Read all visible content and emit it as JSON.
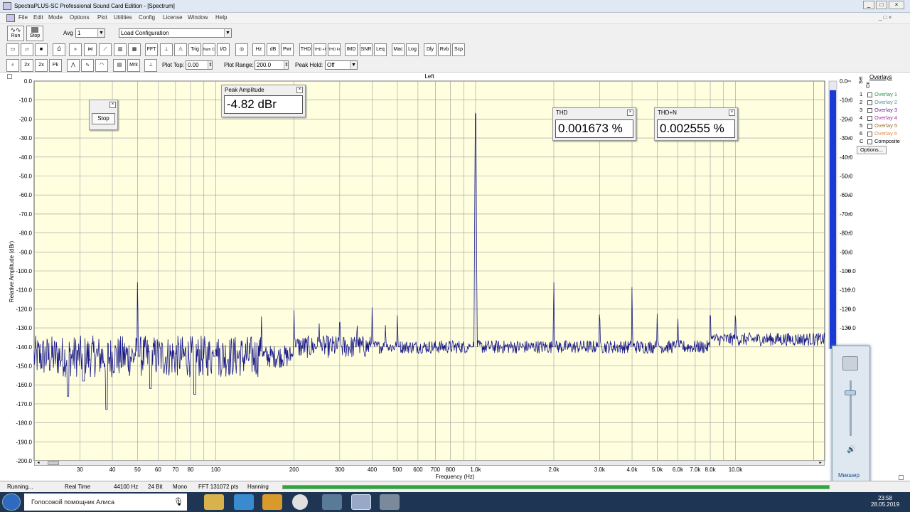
{
  "window": {
    "title": "SpectraPLUS-SC Professional Sound Card Edition - [Spectrum]"
  },
  "menu": [
    "File",
    "Edit",
    "Mode",
    "Options",
    "Plot",
    "Utilities",
    "Config",
    "License",
    "Window",
    "Help"
  ],
  "toolbar": {
    "run_label": "Run",
    "stop_label": "Stop",
    "avg_label": "Avg",
    "avg_value": "1",
    "config_value": "Load Configuration",
    "buttons": [
      "FFT",
      "Trig",
      "Num Ctrl",
      "I/O",
      "Hz",
      "dB",
      "Pwr",
      "THD",
      "THD +N",
      "THD Freq",
      "IMD",
      "SNR",
      "Leq",
      "Mac",
      "Log",
      "Dly",
      "Rvb",
      "Scp"
    ],
    "mrk_label": "Mrk",
    "plot_top_label": "Plot Top:",
    "plot_top_value": "0.00",
    "plot_range_label": "Plot Range:",
    "plot_range_value": "200.0",
    "peak_hold_label": "Peak Hold:",
    "peak_hold_value": "Off"
  },
  "stop_panel": {
    "button": "Stop"
  },
  "peak_panel": {
    "title": "Peak Amplitude",
    "value": "-4.82 dBr"
  },
  "thd_panel": {
    "title": "THD",
    "value": "0.001673 %"
  },
  "thdn_panel": {
    "title": "THD+N",
    "value": "0.002555 %"
  },
  "overlays": {
    "title": "Overlays",
    "set_label": "Set",
    "on_label": "On",
    "items": [
      {
        "num": "1",
        "label": "Overlay 1",
        "color": "#2e9a4a"
      },
      {
        "num": "2",
        "label": "Overlay 2",
        "color": "#4a9a9a"
      },
      {
        "num": "3",
        "label": "Overlay 3",
        "color": "#6a2a8a"
      },
      {
        "num": "4",
        "label": "Overlay 4",
        "color": "#aa2aaa"
      },
      {
        "num": "5",
        "label": "Overlay 5",
        "color": "#9a6a2a"
      },
      {
        "num": "6",
        "label": "Overlay 6",
        "color": "#e28a4a"
      }
    ],
    "composite_num": "C",
    "composite_label": "Composite",
    "options_label": "Options..."
  },
  "chart_data": {
    "type": "line",
    "title": "Left",
    "xlabel": "Frequency (Hz)",
    "ylabel": "Relative Amplitude (dBr)",
    "x_scale": "log",
    "xlim": [
      20,
      22050
    ],
    "ylim": [
      -200,
      0
    ],
    "y_ticks": [
      "0.0",
      "-10.0",
      "-20.0",
      "-30.0",
      "-40.0",
      "-50.0",
      "-60.0",
      "-70.0",
      "-80.0",
      "-90.0",
      "-100.0",
      "-110.0",
      "-120.0",
      "-130.0",
      "-140.0",
      "-150.0",
      "-160.0",
      "-170.0",
      "-180.0",
      "-190.0",
      "-200.0"
    ],
    "x_ticks": [
      {
        "v": 30,
        "t": "30"
      },
      {
        "v": 40,
        "t": "40"
      },
      {
        "v": 50,
        "t": "50"
      },
      {
        "v": 60,
        "t": "60"
      },
      {
        "v": 70,
        "t": "70"
      },
      {
        "v": 80,
        "t": "80"
      },
      {
        "v": 100,
        "t": "100"
      },
      {
        "v": 200,
        "t": "200"
      },
      {
        "v": 300,
        "t": "300"
      },
      {
        "v": 400,
        "t": "400"
      },
      {
        "v": 500,
        "t": "500"
      },
      {
        "v": 600,
        "t": "600"
      },
      {
        "v": 700,
        "t": "700"
      },
      {
        "v": 800,
        "t": "800"
      },
      {
        "v": 1000,
        "t": "1.0k"
      },
      {
        "v": 2000,
        "t": "2.0k"
      },
      {
        "v": 3000,
        "t": "3.0k"
      },
      {
        "v": 4000,
        "t": "4.0k"
      },
      {
        "v": 5000,
        "t": "5.0k"
      },
      {
        "v": 6000,
        "t": "6.0k"
      },
      {
        "v": 7000,
        "t": "7.0k"
      },
      {
        "v": 8000,
        "t": "8.0k"
      },
      {
        "v": 10000,
        "t": "10.0k"
      }
    ],
    "noise_floor": -140,
    "peaks": [
      {
        "x": 1000,
        "y": -4.82
      },
      {
        "x": 50,
        "y": -100
      },
      {
        "x": 100,
        "y": -140
      },
      {
        "x": 150,
        "y": -122
      },
      {
        "x": 200,
        "y": -120
      },
      {
        "x": 250,
        "y": -127
      },
      {
        "x": 300,
        "y": -122
      },
      {
        "x": 350,
        "y": -127
      },
      {
        "x": 400,
        "y": -117
      },
      {
        "x": 450,
        "y": -128
      },
      {
        "x": 500,
        "y": -122
      },
      {
        "x": 2000,
        "y": -103
      },
      {
        "x": 3000,
        "y": -118
      },
      {
        "x": 4000,
        "y": -107
      },
      {
        "x": 5000,
        "y": -122
      },
      {
        "x": 6000,
        "y": -123
      },
      {
        "x": 8000,
        "y": -118
      },
      {
        "x": 10000,
        "y": -120
      }
    ],
    "dips": [
      {
        "x": 27,
        "y": -166
      },
      {
        "x": 31,
        "y": -158
      },
      {
        "x": 38,
        "y": -173
      },
      {
        "x": 56,
        "y": -162
      },
      {
        "x": 83,
        "y": -165
      }
    ],
    "line_color": "#1a1a8a",
    "plot_bg": "#ffffe0",
    "grid_color": "#9a9a9a",
    "level_meter": {
      "ticks": [
        "0.0",
        "-10.0",
        "-20.0",
        "-30.0",
        "-40.0",
        "-50.0",
        "-60.0",
        "-70.0",
        "-80.0",
        "-90.0",
        "-100.0",
        "-110.0",
        "-120.0",
        "-130.0"
      ],
      "level": -4.82,
      "color": "#1a3ad8"
    }
  },
  "mixer": {
    "label": "Микшер"
  },
  "status": {
    "state": "Running...",
    "mode": "Real Time",
    "rate": "44100 Hz",
    "bits": "24 Bit",
    "channels": "Mono",
    "fft": "FFT 131072 pts",
    "window": "Hanning"
  },
  "taskbar": {
    "search": "Голосовой помощник Алиса",
    "time": "23:58",
    "date": "28.05.2019"
  }
}
